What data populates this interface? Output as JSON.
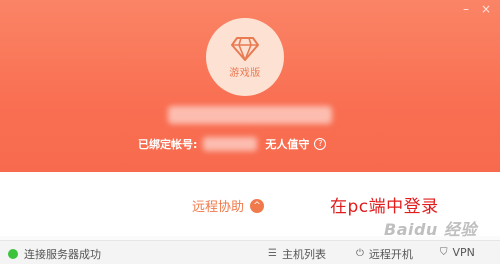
{
  "window": {
    "minimize_glyph": "–",
    "close_glyph": "×"
  },
  "profile": {
    "avatar_icon": "diamond-icon",
    "edition_label": "游戏版",
    "bind_label": "已绑定帐号:",
    "bind_status": "无人值守",
    "help_glyph": "?"
  },
  "main": {
    "remote_assist_label": "远程协助",
    "remote_assist_chevron": "^",
    "annotation": "在pc端中登录"
  },
  "status_bar": {
    "connection_text": "连接服务器成功",
    "host_list_label": "主机列表",
    "host_list_icon": "list-icon",
    "remote_boot_label": "远程开机",
    "remote_boot_icon": "power-icon",
    "vpn_label": "VPN",
    "vpn_icon": "vpn-icon"
  },
  "watermark": {
    "text": "Baidu 经验"
  },
  "colors": {
    "accent": "#f96f52",
    "link": "#f07a4c",
    "annotation": "#e21b1b",
    "online": "#3cc33c"
  }
}
